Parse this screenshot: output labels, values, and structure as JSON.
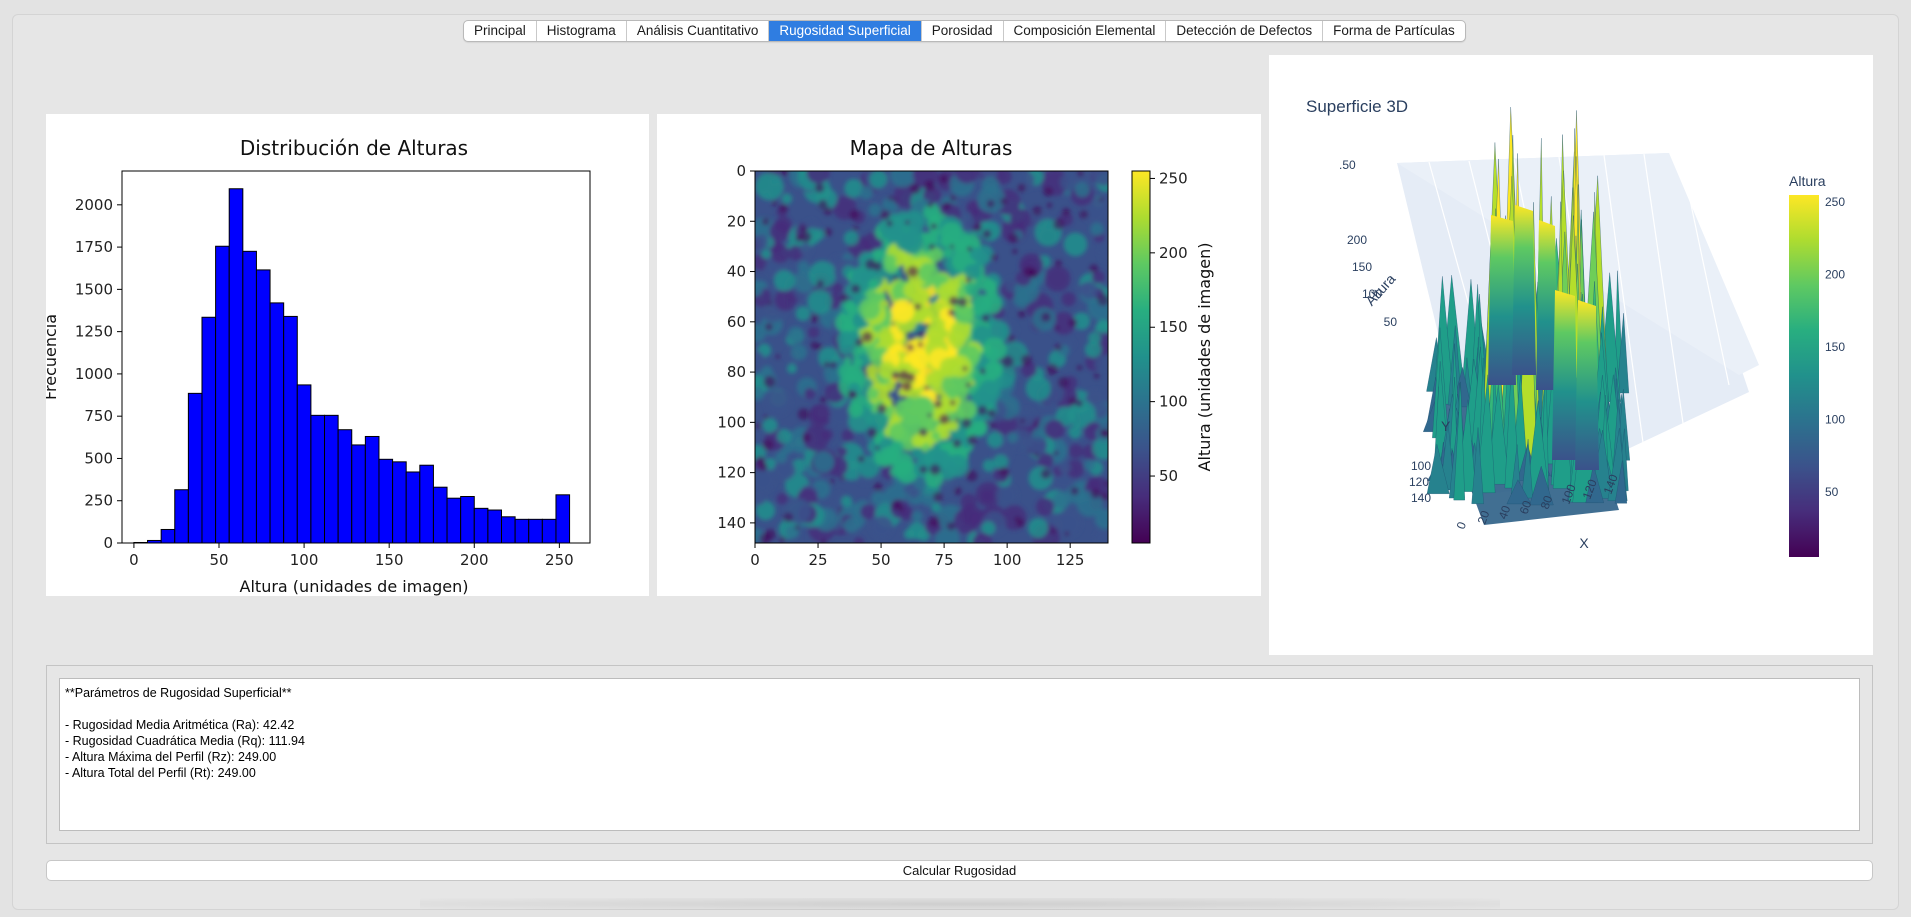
{
  "tabs": [
    {
      "label": "Principal",
      "active": false
    },
    {
      "label": "Histograma",
      "active": false
    },
    {
      "label": "Análisis Cuantitativo",
      "active": false
    },
    {
      "label": "Rugosidad Superficial",
      "active": true
    },
    {
      "label": "Porosidad",
      "active": false
    },
    {
      "label": "Composición Elemental",
      "active": false
    },
    {
      "label": "Detección de Defectos",
      "active": false
    },
    {
      "label": "Forma de Partículas",
      "active": false
    }
  ],
  "histogram": {
    "chart_data": {
      "type": "bar",
      "title": "Distribución de Alturas",
      "xlabel": "Altura (unidades de imagen)",
      "ylabel": "Frecuencia",
      "xlim": [
        -7,
        268
      ],
      "ylim": [
        0,
        2200
      ],
      "xticks": [
        0,
        50,
        100,
        150,
        200,
        250
      ],
      "yticks": [
        0,
        250,
        500,
        750,
        1000,
        1250,
        1500,
        1750,
        2000
      ],
      "bar_color": "#0000ff",
      "bins": [
        {
          "x0": 0,
          "x1": 8,
          "v": 3
        },
        {
          "x0": 8,
          "x1": 16,
          "v": 15
        },
        {
          "x0": 16,
          "x1": 24,
          "v": 80
        },
        {
          "x0": 24,
          "x1": 32,
          "v": 315
        },
        {
          "x0": 32,
          "x1": 40,
          "v": 885
        },
        {
          "x0": 40,
          "x1": 48,
          "v": 1335
        },
        {
          "x0": 48,
          "x1": 56,
          "v": 1755
        },
        {
          "x0": 56,
          "x1": 64,
          "v": 2095
        },
        {
          "x0": 64,
          "x1": 72,
          "v": 1725
        },
        {
          "x0": 72,
          "x1": 80,
          "v": 1615
        },
        {
          "x0": 80,
          "x1": 88,
          "v": 1420
        },
        {
          "x0": 88,
          "x1": 96,
          "v": 1340
        },
        {
          "x0": 96,
          "x1": 104,
          "v": 935
        },
        {
          "x0": 104,
          "x1": 112,
          "v": 755
        },
        {
          "x0": 112,
          "x1": 120,
          "v": 755
        },
        {
          "x0": 120,
          "x1": 128,
          "v": 670
        },
        {
          "x0": 128,
          "x1": 136,
          "v": 580
        },
        {
          "x0": 136,
          "x1": 144,
          "v": 630
        },
        {
          "x0": 144,
          "x1": 152,
          "v": 495
        },
        {
          "x0": 152,
          "x1": 160,
          "v": 480
        },
        {
          "x0": 160,
          "x1": 168,
          "v": 420
        },
        {
          "x0": 168,
          "x1": 176,
          "v": 460
        },
        {
          "x0": 176,
          "x1": 184,
          "v": 330
        },
        {
          "x0": 184,
          "x1": 192,
          "v": 265
        },
        {
          "x0": 192,
          "x1": 200,
          "v": 275
        },
        {
          "x0": 200,
          "x1": 208,
          "v": 205
        },
        {
          "x0": 208,
          "x1": 216,
          "v": 195
        },
        {
          "x0": 216,
          "x1": 224,
          "v": 155
        },
        {
          "x0": 224,
          "x1": 232,
          "v": 140
        },
        {
          "x0": 232,
          "x1": 240,
          "v": 140
        },
        {
          "x0": 240,
          "x1": 248,
          "v": 140
        },
        {
          "x0": 248,
          "x1": 256,
          "v": 285
        }
      ]
    }
  },
  "heightmap": {
    "chart_data": {
      "type": "heatmap",
      "title": "Mapa de Alturas",
      "xlim": [
        0,
        140
      ],
      "ylim": [
        0,
        148
      ],
      "xticks": [
        0,
        25,
        50,
        75,
        100,
        125
      ],
      "yticks": [
        0,
        20,
        40,
        60,
        80,
        100,
        120,
        140
      ],
      "colorbar_label": "Altura (unidades de imagen)",
      "colorbar_range": [
        5,
        255
      ],
      "colorbar_ticks": [
        50,
        100,
        150,
        200,
        250
      ],
      "colormap": "viridis",
      "colors": [
        "#440154",
        "#472d7b",
        "#3b528b",
        "#2c728e",
        "#21918c",
        "#28ae80",
        "#5ec962",
        "#addc30",
        "#fde725"
      ]
    }
  },
  "surface3d": {
    "chart_data": {
      "type": "surface",
      "title": "Superficie 3D",
      "axes": {
        "x": "X",
        "y": "Y",
        "z": "Altura"
      },
      "x_ticks": [
        0,
        20,
        40,
        60,
        80,
        100,
        120,
        140
      ],
      "y_ticks": [
        140,
        120,
        100
      ],
      "z_ticks": [
        50,
        100,
        150,
        200,
        250
      ],
      "colorbar_title": "Altura",
      "colorbar_ticks": [
        50,
        100,
        150,
        200,
        250
      ],
      "colormap": "viridis"
    }
  },
  "results": {
    "lines": [
      "**Parámetros de Rugosidad Superficial**",
      "",
      "- Rugosidad Media Aritmética (Ra): 42.42",
      "- Rugosidad Cuadrática Media (Rq): 111.94",
      "- Altura Máxima del Perfil (Rz): 249.00",
      "- Altura Total del Perfil (Rt): 249.00"
    ]
  },
  "button": {
    "label": "Calcular Rugosidad"
  }
}
